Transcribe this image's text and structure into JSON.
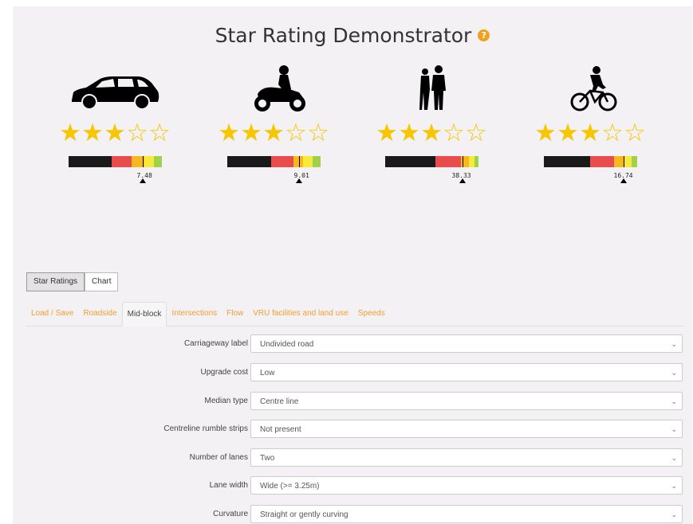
{
  "title": "Star Rating Demonstrator",
  "help_icon": "?",
  "colors": {
    "star": "#f7c600",
    "accent_tab": "#f0a030",
    "bar_segments": [
      "#1a1a1a",
      "#e84c4c",
      "#f6b81c",
      "#f8ea3a",
      "#9fd24a"
    ]
  },
  "road_users": [
    {
      "icon": "car-icon",
      "stars_filled": 3,
      "stars_total": 5,
      "score": "7.48",
      "marker_fraction": 0.72
    },
    {
      "icon": "motorcycle-icon",
      "stars_filled": 3,
      "stars_total": 5,
      "score": "9.01",
      "marker_fraction": 0.76
    },
    {
      "icon": "pedestrian-icon",
      "stars_filled": 3,
      "stars_total": 5,
      "score": "38.33",
      "marker_fraction": 0.83
    },
    {
      "icon": "bicycle-icon",
      "stars_filled": 3,
      "stars_total": 5,
      "score": "16.74",
      "marker_fraction": 0.85
    }
  ],
  "view_tabs": {
    "star_ratings": "Star Ratings",
    "chart": "Chart",
    "active": "star_ratings"
  },
  "section_tabs": {
    "load_save": "Load / Save",
    "roadside": "Roadside",
    "mid_block": "Mid-block",
    "intersections": "Intersections",
    "flow": "Flow",
    "vru": "VRU facilities and land use",
    "speeds": "Speeds",
    "active": "mid_block"
  },
  "fields": {
    "carriageway_label": {
      "label": "Carriageway label",
      "value": "Undivided road"
    },
    "upgrade_cost": {
      "label": "Upgrade cost",
      "value": "Low"
    },
    "median_type": {
      "label": "Median type",
      "value": "Centre line"
    },
    "centreline_rumble": {
      "label": "Centreline rumble strips",
      "value": "Not present"
    },
    "number_of_lanes": {
      "label": "Number of lanes",
      "value": "Two"
    },
    "lane_width": {
      "label": "Lane width",
      "value": "Wide (>= 3.25m)"
    },
    "curvature": {
      "label": "Curvature",
      "value": "Straight or gently curving"
    }
  }
}
